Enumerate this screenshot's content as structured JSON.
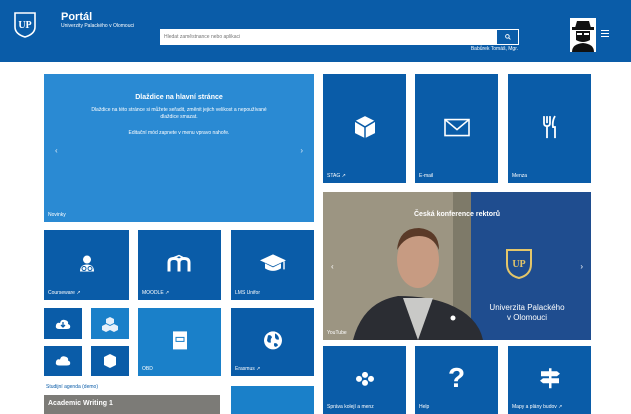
{
  "header": {
    "title": "Portál",
    "subtitle": "Univerzity Palackého v Olomouci",
    "search_placeholder": "Hledat zaměstnance nebo aplikaci",
    "user_name": "Babůrek Tomáš, Mgr."
  },
  "slider": {
    "title": "Dlaždice na hlavní stránce",
    "text1": "Dlaždice na této stránce si můžete seřadit, změnit jejich velikost a nepoužívané dlaždice smazat.",
    "text2": "Editační mód zapnete v menu vpravo nahoře.",
    "label": "Novinky"
  },
  "tiles": {
    "stag": "STAG ↗",
    "email": "E-mail",
    "menza": "Menza",
    "courseware": "Courseware ↗",
    "moodle": "MOODLE ↗",
    "lms": "LMS Unifor",
    "obd": "OBD",
    "erasmus": "Erasmus ↗",
    "koleje": "Správa kolejí a menz",
    "help": "Help",
    "mapy": "Mapy a plány budov ↗"
  },
  "video": {
    "title": "Česká konference rektorů",
    "label": "YouTube",
    "banner_line1": "Univerzita Palackého",
    "banner_line2": "v Olomouci"
  },
  "agenda": {
    "label": "Studijní agenda (demo)",
    "course": "Academic Writing 1"
  },
  "icons": [
    "university-logo",
    "search-icon",
    "menu-icon",
    "cube-icon",
    "mail-icon",
    "cutlery-icon",
    "courseware-icon",
    "moodle-icon",
    "graduation-cap-icon",
    "cloud-download-icon",
    "cubes-icon",
    "cloud-icon",
    "box-icon",
    "book-icon",
    "globe-icon",
    "dots-icon",
    "question-icon",
    "signpost-icon"
  ],
  "colors": {
    "header": "#0a5ca8",
    "tile": "#0a5ca8",
    "tile_light": "#1a80c9"
  }
}
